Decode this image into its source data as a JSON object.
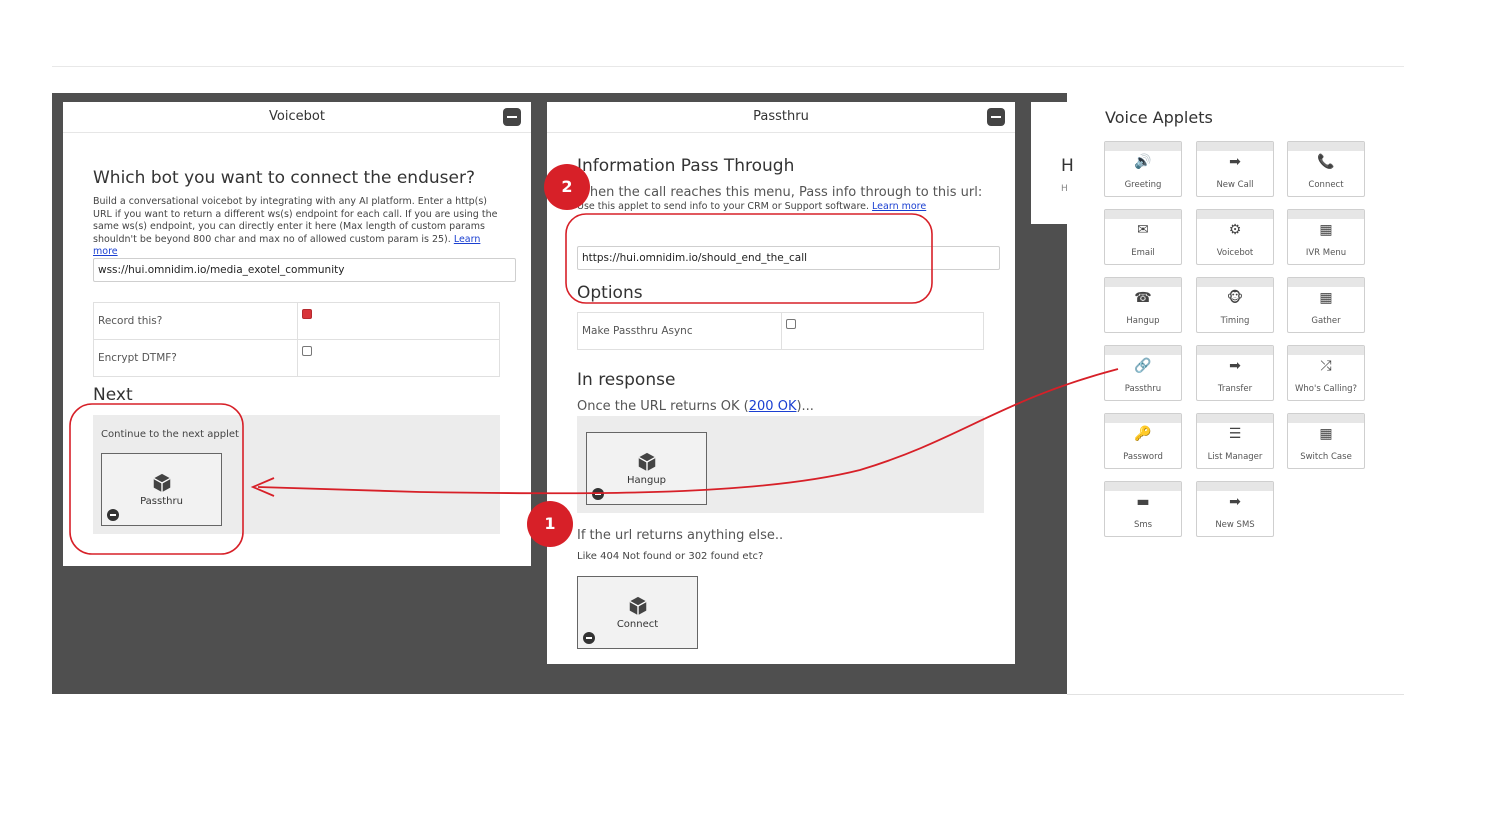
{
  "voicebot": {
    "header": "Voicebot",
    "question": "Which bot you want to connect the enduser?",
    "description": "Build a conversational voicebot by integrating with any AI platform. Enter a http(s) URL if you want to return a different ws(s) endpoint for each call. If you are using the same ws(s) endpoint, you can directly enter it here (Max length of custom params shouldn't be beyond 800 char and max no of allowed custom param is 25).",
    "learn_more": "Learn more",
    "url_value": "wss://hui.omnidim.io/media_exotel_community",
    "options": [
      {
        "label": "Record this?",
        "checked": true
      },
      {
        "label": "Encrypt DTMF?",
        "checked": false
      }
    ],
    "next_label": "Next",
    "continue_text": "Continue to the next applet",
    "next_applet": "Passthru"
  },
  "passthru": {
    "header": "Passthru",
    "section_title": "Information Pass Through",
    "info_line": "When the call reaches this menu, Pass info through to this url:",
    "info_sub": "Use this applet to send info to your CRM or Support software.",
    "learn_more": "Learn more",
    "url_value": "https://hui.omnidim.io/should_end_the_call",
    "options_title": "Options",
    "option_label": "Make Passthru Async",
    "option_checked": false,
    "in_response_title": "In response",
    "ok_prefix": "Once the URL returns OK (",
    "ok_link": "200 OK",
    "ok_suffix": ")...",
    "ok_applet": "Hangup",
    "else_title": "If the url returns anything else..",
    "else_sub": "Like 404 Not found or 302 found etc?",
    "else_applet": "Connect"
  },
  "peek_panel": {
    "letter": "H",
    "sub": "H"
  },
  "sidebar": {
    "title": "Voice Applets",
    "applets": [
      {
        "label": "Greeting",
        "icon": "speaker-icon",
        "glyph": "🔊"
      },
      {
        "label": "New Call",
        "icon": "arrow-right-icon",
        "glyph": "➡"
      },
      {
        "label": "Connect",
        "icon": "phone-icon",
        "glyph": "📞"
      },
      {
        "label": "Email",
        "icon": "envelope-icon",
        "glyph": "✉"
      },
      {
        "label": "Voicebot",
        "icon": "robot-icon",
        "glyph": "⚙"
      },
      {
        "label": "IVR Menu",
        "icon": "grid-icon",
        "glyph": "▦"
      },
      {
        "label": "Hangup",
        "icon": "hangup-icon",
        "glyph": "☎"
      },
      {
        "label": "Timing",
        "icon": "monkey-icon",
        "glyph": "🐵"
      },
      {
        "label": "Gather",
        "icon": "grid-icon",
        "glyph": "▦"
      },
      {
        "label": "Passthru",
        "icon": "link-icon",
        "glyph": "🔗"
      },
      {
        "label": "Transfer",
        "icon": "arrow-right-icon",
        "glyph": "➡"
      },
      {
        "label": "Who's Calling?",
        "icon": "branch-icon",
        "glyph": "⤮"
      },
      {
        "label": "Password",
        "icon": "key-icon",
        "glyph": "🔑"
      },
      {
        "label": "List Manager",
        "icon": "list-icon",
        "glyph": "☰"
      },
      {
        "label": "Switch Case",
        "icon": "grid-icon",
        "glyph": "▦"
      },
      {
        "label": "Sms",
        "icon": "sms-icon",
        "glyph": "▬"
      },
      {
        "label": "New SMS",
        "icon": "arrow-right-icon",
        "glyph": "➡"
      }
    ]
  },
  "annotations": {
    "badge1": "1",
    "badge2": "2",
    "accent": "#d72028"
  }
}
